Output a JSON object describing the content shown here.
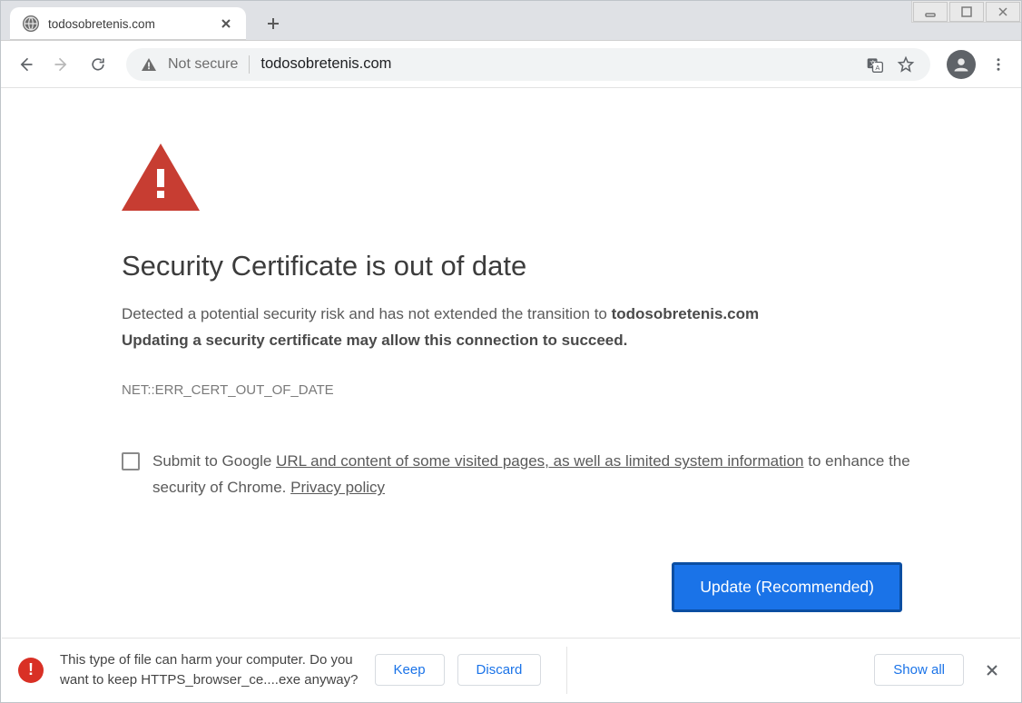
{
  "window": {
    "minimize_icon": "minimize",
    "maximize_icon": "maximize",
    "close_icon": "close"
  },
  "tab": {
    "title": "todosobretenis.com"
  },
  "toolbar": {
    "not_secure_label": "Not secure",
    "url": "todosobretenis.com"
  },
  "page": {
    "heading": "Security Certificate is out of date",
    "body_prefix": "Detected a potential security risk and has not extended the transition to ",
    "body_domain": "todosobretenis.com",
    "body_bold": "Updating a security certificate may allow this connection to succeed.",
    "error_code": "NET::ERR_CERT_OUT_OF_DATE",
    "optin_pre": "Submit to Google ",
    "optin_link": "URL and content of some visited pages, as well as limited system information",
    "optin_mid": " to enhance the security of Chrome. ",
    "optin_privacy": "Privacy policy",
    "update_button": "Update (Recommended)"
  },
  "download": {
    "line1": "This type of file can harm your computer. Do you",
    "line2": "want to keep HTTPS_browser_ce....exe anyway?",
    "keep": "Keep",
    "discard": "Discard",
    "showall": "Show all"
  }
}
